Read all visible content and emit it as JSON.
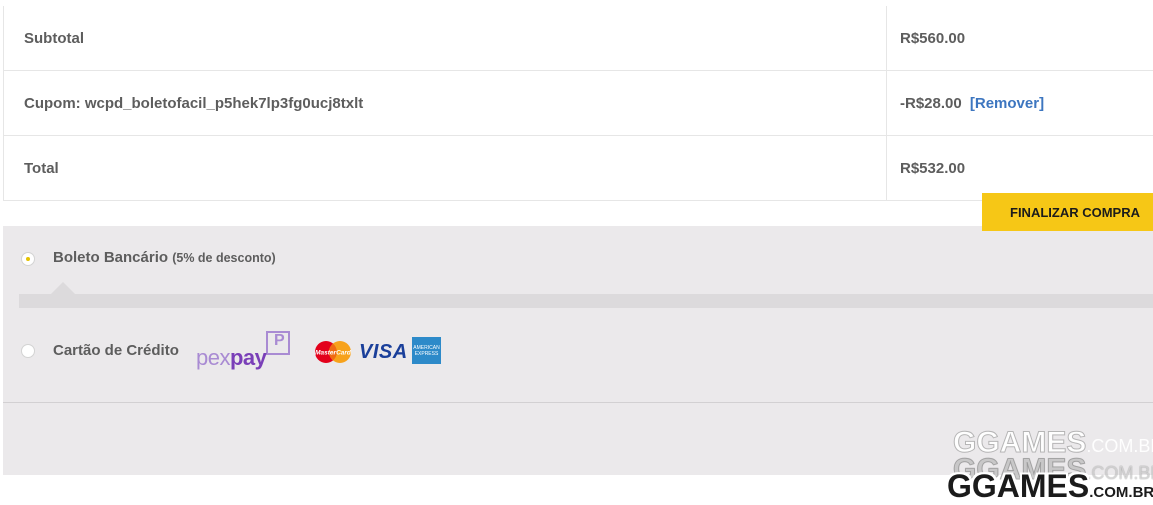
{
  "totals": {
    "rows": [
      {
        "label": "Subtotal",
        "value": "R$560.00"
      },
      {
        "label": "Cupom: wcpd_boletofacil_p5hek7lp3fg0ucj8txlt",
        "value": "-R$28.00",
        "link": "[Remover]"
      },
      {
        "label": "Total",
        "value": "R$532.00"
      }
    ]
  },
  "payment": {
    "methods": [
      {
        "label": "Boleto Bancário",
        "note": "(5% de desconto)",
        "selected": true
      },
      {
        "label": "Cartão de Crédito",
        "selected": false
      }
    ],
    "logos": {
      "pexpay_a": "pex",
      "pexpay_b": "pay",
      "pexpay_box": "P",
      "mastercard": "MasterCard",
      "visa": "VISA",
      "amex": "AMERICAN EXPRESS"
    }
  },
  "finish_button": "FINALIZAR COMPRA",
  "watermark": {
    "brand": "GGAMES",
    "domain": ".COM.BR"
  },
  "colors": {
    "accent": "#f6c716",
    "link": "#3d76c0",
    "panel": "#ebe9eb"
  }
}
